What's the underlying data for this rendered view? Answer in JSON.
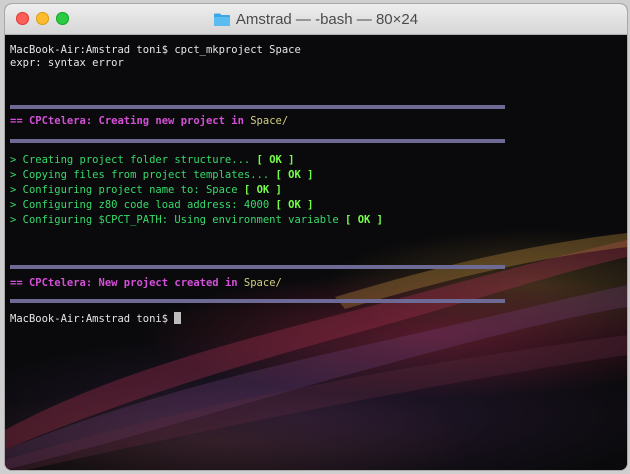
{
  "window": {
    "title": "Amstrad — -bash — 80×24"
  },
  "terminal": {
    "line1": "MacBook-Air:Amstrad toni$ cpct_mkproject Space",
    "line2": "expr: syntax error",
    "banner1": {
      "prefix": "== ",
      "brand": "CPCtelera:",
      "text": " Creating new project in ",
      "target": "Space/"
    },
    "steps": [
      {
        "text": "> Creating project folder structure... ",
        "open": "[ ",
        "ok": "OK",
        "close": " ]"
      },
      {
        "text": "> Copying files from project templates... ",
        "open": "[ ",
        "ok": "OK",
        "close": " ]"
      },
      {
        "text": "> Configuring project name to: Space ",
        "open": "[ ",
        "ok": "OK",
        "close": " ]"
      },
      {
        "text": "> Configuring z80 code load address: 4000 ",
        "open": "[ ",
        "ok": "OK",
        "close": " ]"
      },
      {
        "text": "> Configuring $CPCT_PATH: Using environment variable ",
        "open": "[ ",
        "ok": "OK",
        "close": " ]"
      }
    ],
    "banner2": {
      "prefix": "== ",
      "brand": "CPCtelera:",
      "text": " New project created in ",
      "target": "Space/"
    },
    "prompt": "MacBook-Air:Amstrad toni$ "
  }
}
